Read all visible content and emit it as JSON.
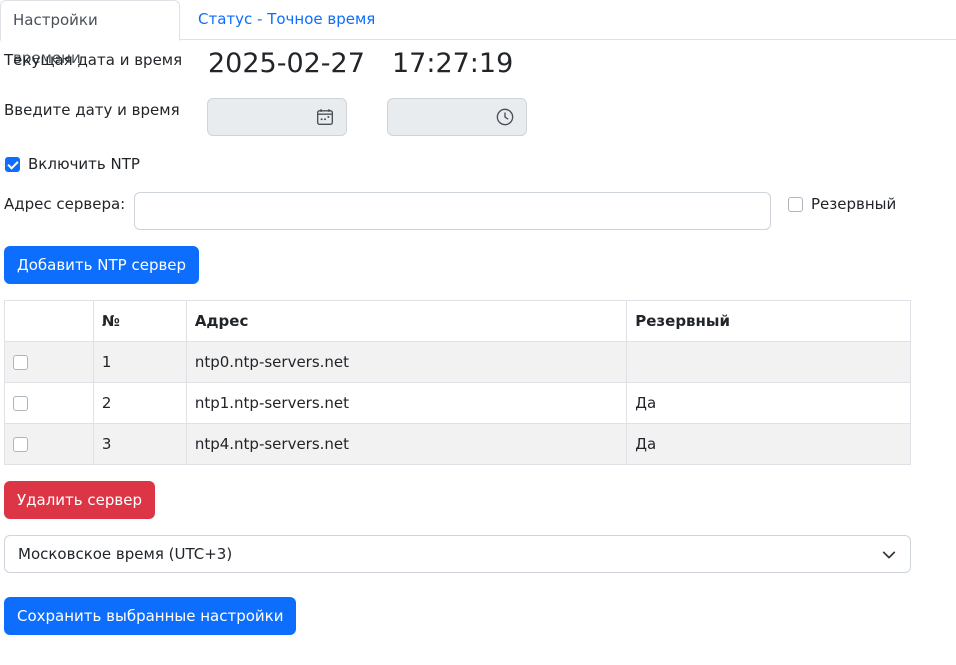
{
  "tabs": [
    {
      "label": "Настройки времени",
      "active": true
    },
    {
      "label": "Статус - Точное время",
      "active": false
    }
  ],
  "current": {
    "label": "Текущая дата и время",
    "date": "2025-02-27",
    "time": "17:27:19"
  },
  "input_datetime": {
    "label": "Введите дату и время",
    "date_value": "",
    "time_value": ""
  },
  "ntp": {
    "enable_label": "Включить NTP",
    "enabled": true,
    "server_label": "Адрес сервера:",
    "server_value": "",
    "reserve_label": "Резервный",
    "reserve_checked": false,
    "add_button": "Добавить NTP сервер"
  },
  "table": {
    "headers": [
      "",
      "№",
      "Адрес",
      "Резервный"
    ],
    "rows": [
      {
        "num": "1",
        "address": "ntp0.ntp-servers.net",
        "reserve": ""
      },
      {
        "num": "2",
        "address": "ntp1.ntp-servers.net",
        "reserve": "Да"
      },
      {
        "num": "3",
        "address": "ntp4.ntp-servers.net",
        "reserve": "Да"
      }
    ]
  },
  "delete_button": "Удалить сервер",
  "timezone": {
    "selected": "Московское время (UTC+3)"
  },
  "save_button": "Сохранить выбранные настройки",
  "colors": {
    "primary": "#0d6efd",
    "danger": "#dc3545"
  },
  "icons": [
    "calendar-icon",
    "clock-icon",
    "chevron-down-icon"
  ]
}
